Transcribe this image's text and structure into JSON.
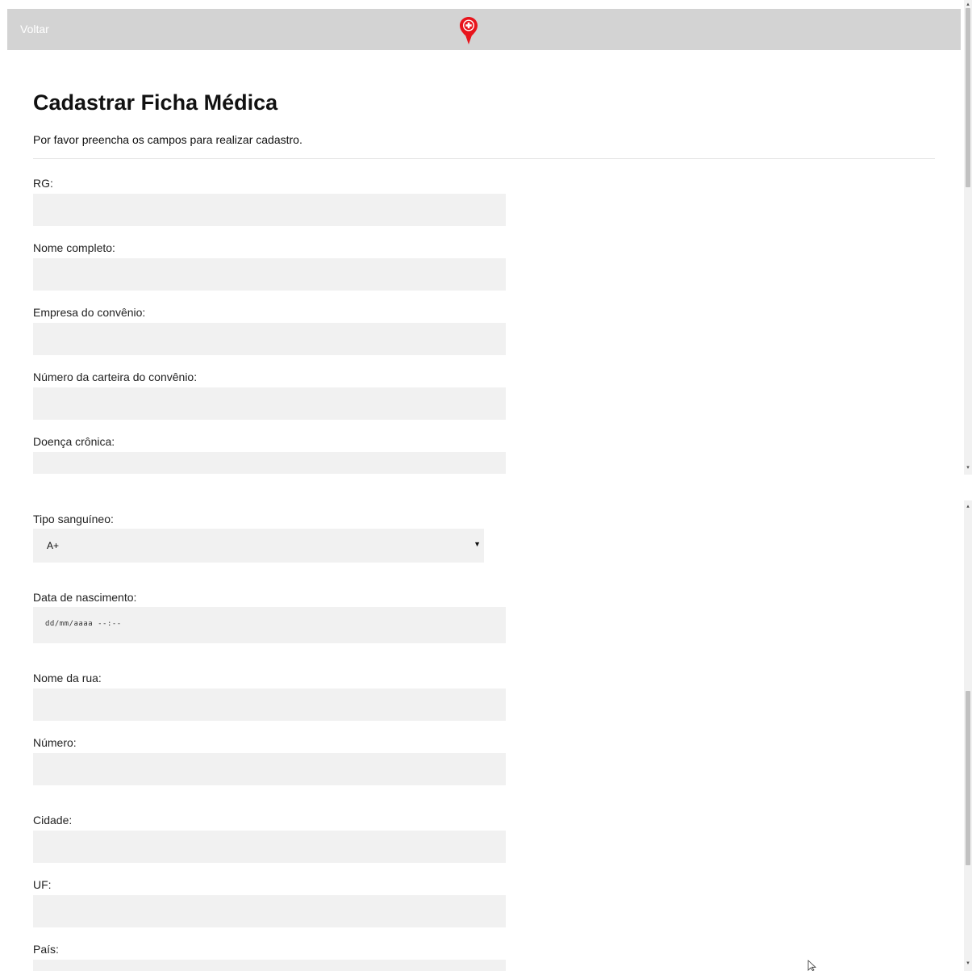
{
  "nav": {
    "back_label": "Voltar",
    "brand_color": "#e8141c"
  },
  "header": {
    "title": "Cadastrar Ficha Médica",
    "subtitle": "Por favor preencha os campos para realizar cadastro."
  },
  "form": {
    "rg": {
      "label": "RG:",
      "value": ""
    },
    "nome_completo": {
      "label": "Nome completo:",
      "value": ""
    },
    "empresa_convenio": {
      "label": "Empresa do convênio:",
      "value": ""
    },
    "numero_carteira": {
      "label": "Número da carteira do convênio:",
      "value": ""
    },
    "doenca_cronica": {
      "label": "Doença crônica:",
      "value": ""
    },
    "tipo_sanguineo": {
      "label": "Tipo sanguíneo:",
      "selected": "A+"
    },
    "data_nascimento": {
      "label": "Data de nascimento:",
      "placeholder": "dd/mm/aaaa --:--"
    },
    "nome_rua": {
      "label": "Nome da rua:",
      "value": ""
    },
    "numero": {
      "label": "Número:",
      "value": ""
    },
    "cidade": {
      "label": "Cidade:",
      "value": ""
    },
    "uf": {
      "label": "UF:",
      "value": ""
    },
    "pais": {
      "label": "País:",
      "value": ""
    }
  },
  "icons": {
    "logo": "medical-location-pin-icon",
    "select_caret": "caret-down-icon",
    "cursor": "mouse-pointer-icon"
  }
}
